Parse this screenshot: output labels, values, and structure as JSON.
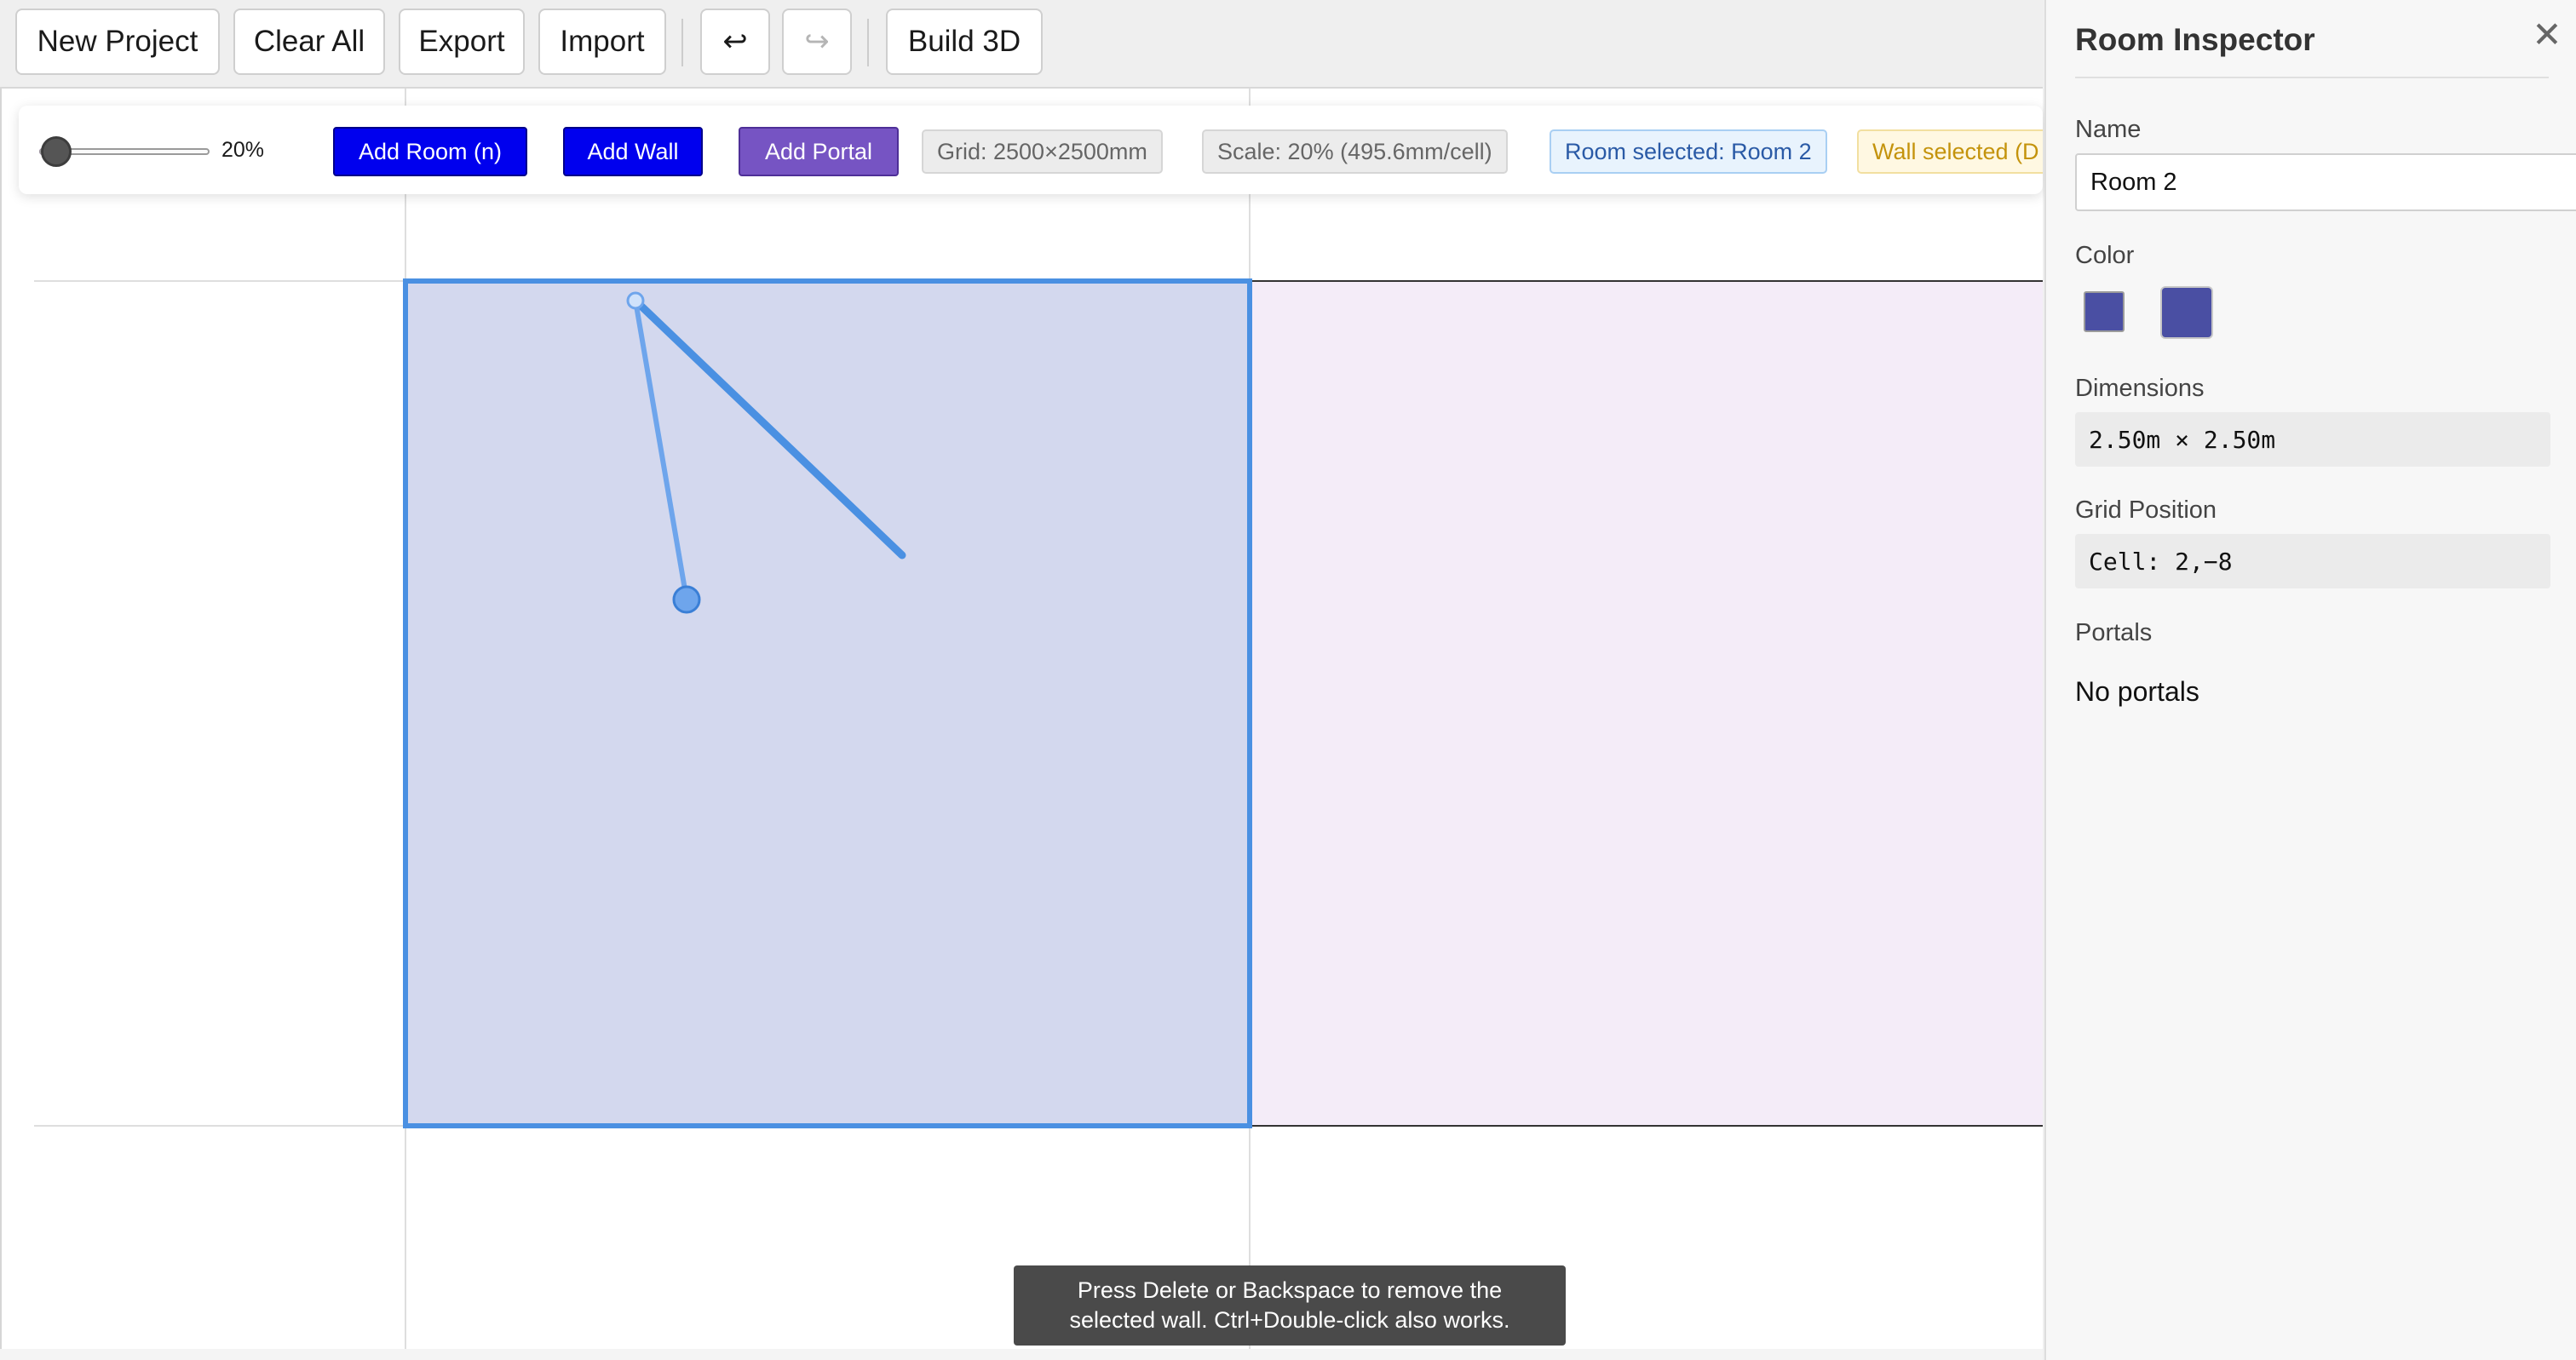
{
  "toolbar": {
    "new_project": "New Project",
    "clear_all": "Clear All",
    "export": "Export",
    "import": "Import",
    "undo_icon": "↩",
    "redo_icon": "↪",
    "build_3d": "Build 3D"
  },
  "tool_row": {
    "zoom_percent": 20,
    "zoom_label": "20%",
    "add_room": "Add Room (n)",
    "add_wall": "Add Wall",
    "add_portal": "Add Portal",
    "grid_chip": "Grid: 2500×2500mm",
    "scale_chip": "Scale: 20% (495.6mm/cell)",
    "room_selected_chip": "Room selected: Room 2",
    "wall_selected_chip": "Wall selected (D"
  },
  "canvas": {
    "rooms": [
      {
        "name": "Room 2",
        "grid_cell": "2,-8",
        "fill": "#d3d8ee",
        "border": "#4a90e2",
        "selected": true
      },
      {
        "name": "",
        "fill": "#f4ecf8",
        "border": "#333333",
        "selected": false
      }
    ],
    "wall_color": "#4a90e2"
  },
  "toast": {
    "line1": "Press Delete or Backspace to remove the",
    "line2": "selected wall. Ctrl+Double-click also works."
  },
  "inspector": {
    "title": "Room Inspector",
    "close_icon": "✕",
    "name_label": "Name",
    "name_value": "Room 2",
    "color_label": "Color",
    "color_value": "#4a4fa3",
    "dimensions_label": "Dimensions",
    "dimensions_value": "2.50m × 2.50m",
    "grid_position_label": "Grid Position",
    "grid_position_value": "Cell: 2,−8",
    "portals_label": "Portals",
    "portals_value": "No portals"
  },
  "icons": {
    "undo": "undo-icon",
    "redo": "redo-icon",
    "close": "close-icon"
  }
}
